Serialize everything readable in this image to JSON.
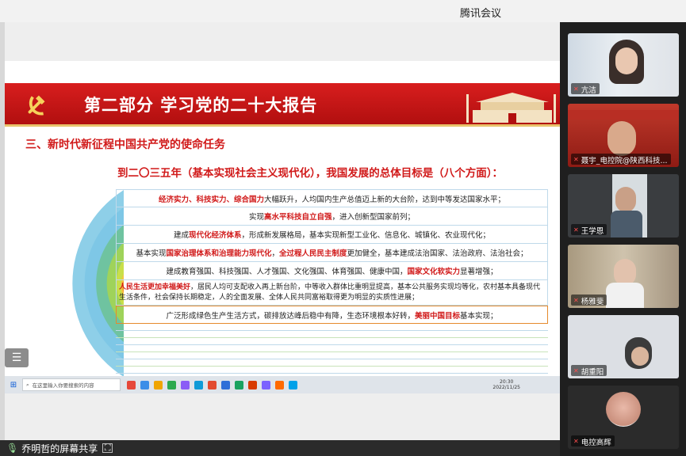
{
  "window": {
    "title": "腾讯会议"
  },
  "slide": {
    "banner_title": "第二部分 学习党的二十大报告",
    "section_title": "三、新时代新征程中国共产党的使命任务",
    "subtitle": "到二〇三五年（基本实现社会主义现代化），我国发展的总体目标是（八个方面）：",
    "rows": [
      {
        "parts": [
          {
            "t": "经济实力、科技实力、综合国力",
            "red": true
          },
          {
            "t": "大幅跃升，人均国内生产总值迈上新的大台阶，达到中等发达国家水平；",
            "red": false
          }
        ]
      },
      {
        "parts": [
          {
            "t": "实现",
            "red": false
          },
          {
            "t": "高水平科技自立自强",
            "red": true
          },
          {
            "t": "，进入创新型国家前列；",
            "red": false
          }
        ]
      },
      {
        "parts": [
          {
            "t": "建成",
            "red": false
          },
          {
            "t": "现代化经济体系",
            "red": true
          },
          {
            "t": "，形成新发展格局，基本实现新型工业化、信息化、城镇化、农业现代化；",
            "red": false
          }
        ]
      },
      {
        "parts": [
          {
            "t": "基本实现",
            "red": false
          },
          {
            "t": "国家治理体系和治理能力现代化",
            "red": true
          },
          {
            "t": "，",
            "red": false
          },
          {
            "t": "全过程人民民主制度",
            "red": true
          },
          {
            "t": "更加健全，基本建成法治国家、法治政府、法治社会；",
            "red": false
          }
        ]
      },
      {
        "parts": [
          {
            "t": "建成教育强国、科技强国、人才强国、文化强国、体育强国、健康中国，",
            "red": false
          },
          {
            "t": "国家文化软实力",
            "red": true
          },
          {
            "t": "显著增强；",
            "red": false
          }
        ]
      },
      {
        "parts": [
          {
            "t": "人民生活更加幸福美好",
            "red": true
          },
          {
            "t": "，居民人均可支配收入再上新台阶，中等收入群体比重明显提高，基本公共服务实现均等化，农村基本具备现代生活条件，社会保持长期稳定，人的全面发展、全体人民共同富裕取得更为明显的实质性进展；",
            "red": false
          }
        ]
      },
      {
        "parts": [
          {
            "t": "广泛形成绿色生产生活方式，碳排放达峰后稳中有降，生态环境根本好转，",
            "red": false
          },
          {
            "t": "美丽中国目标",
            "red": true
          },
          {
            "t": "基本实现；",
            "red": false
          }
        ]
      }
    ]
  },
  "presenter_taskbar": {
    "search_placeholder": "在这里输入你要搜索的内容",
    "clock_time": "20:30",
    "clock_date": "2022/11/25",
    "app_colors": [
      "#e6483a",
      "#3b8ee8",
      "#f0a500",
      "#2da94f",
      "#8b5cf6",
      "#0f9bd7",
      "#e24a2f",
      "#2f6fd8",
      "#1aa260",
      "#d83b01",
      "#7b61ff",
      "#ff6a00",
      "#00a1e9"
    ]
  },
  "bottombar": {
    "share_label": "乔明哲的屏幕共享"
  },
  "participants": [
    {
      "name": "亢洁",
      "bg": "#c9d4de"
    },
    {
      "name": "聂宇_电控院@陕西科技...",
      "bg": "#b8352f"
    },
    {
      "name": "王学恩",
      "bg": "#7d8a8c"
    },
    {
      "name": "杨雅斐",
      "bg": "#b9aa92"
    },
    {
      "name": "胡重阳",
      "bg": "#d9dbe0"
    },
    {
      "name": "电控高辉",
      "bg": "#2b2b2b"
    }
  ]
}
